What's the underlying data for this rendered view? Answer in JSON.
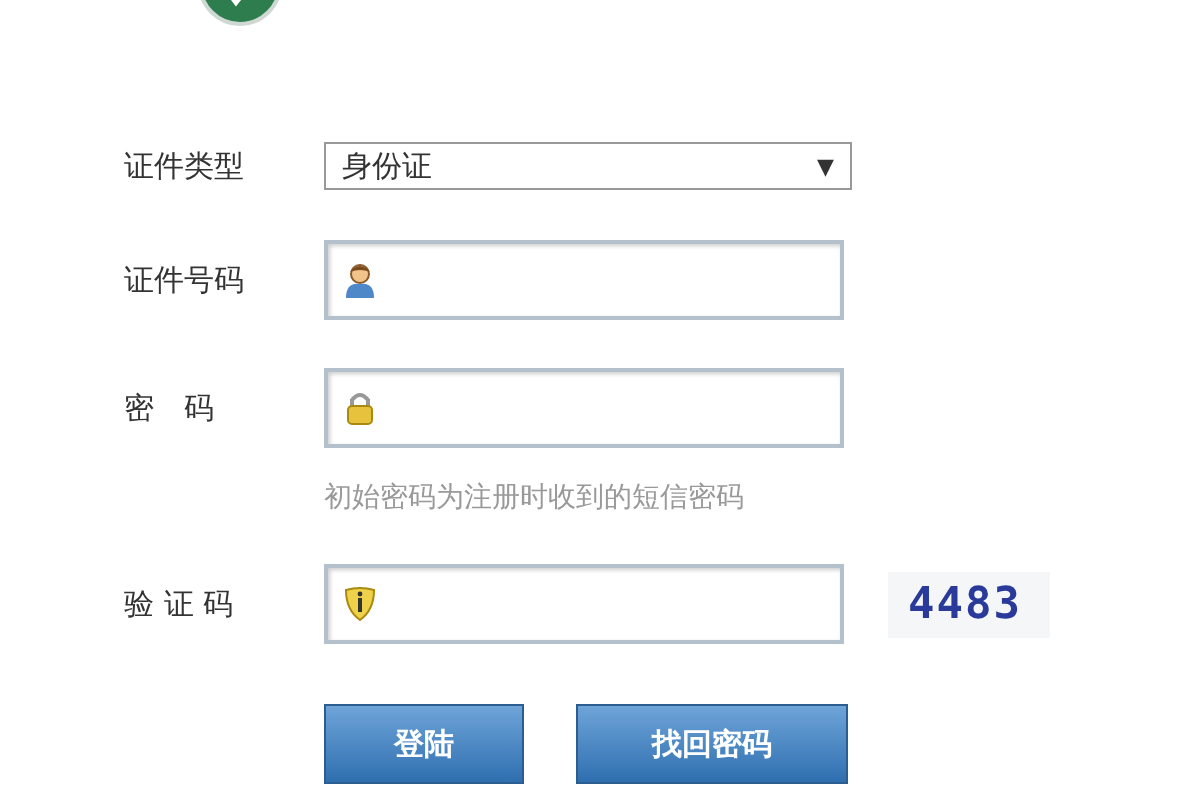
{
  "form": {
    "fields": [
      {
        "kind": "select",
        "label": "证件类型",
        "value": "身份证",
        "caret": "▼"
      },
      {
        "kind": "id",
        "label": "证件号码"
      },
      {
        "kind": "password",
        "label": "密　码",
        "hint": "初始密码为注册时收到的短信密码"
      },
      {
        "kind": "captcha",
        "label": "验 证 码",
        "code": "4483"
      }
    ]
  },
  "buttons": [
    "登陆",
    "找回密码"
  ]
}
